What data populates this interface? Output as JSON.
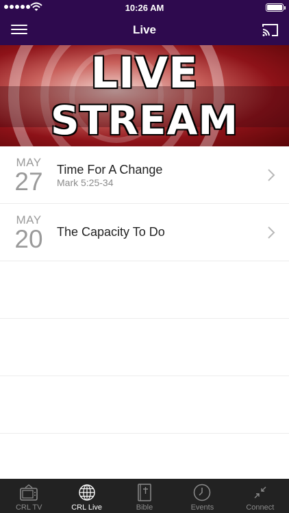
{
  "status_bar": {
    "time": "10:26 AM"
  },
  "header": {
    "title": "Live"
  },
  "banner": {
    "line1": "LIVE",
    "line2": "STREAM"
  },
  "sermons": [
    {
      "month": "MAY",
      "day": "27",
      "title": "Time For A Change",
      "subtitle": "Mark 5:25-34"
    },
    {
      "month": "MAY",
      "day": "20",
      "title": "The Capacity To Do",
      "subtitle": ""
    }
  ],
  "tabs": [
    {
      "label": "CRL TV",
      "icon": "tv-icon",
      "active": false
    },
    {
      "label": "CRL Live",
      "icon": "globe-icon",
      "active": true
    },
    {
      "label": "Bible",
      "icon": "bible-icon",
      "active": false
    },
    {
      "label": "Events",
      "icon": "clock-icon",
      "active": false
    },
    {
      "label": "Connect",
      "icon": "connect-icon",
      "active": false
    }
  ],
  "colors": {
    "header_bg": "#2e0a4e",
    "tabbar_bg": "#222222",
    "date_gray": "#9a9a9a"
  }
}
